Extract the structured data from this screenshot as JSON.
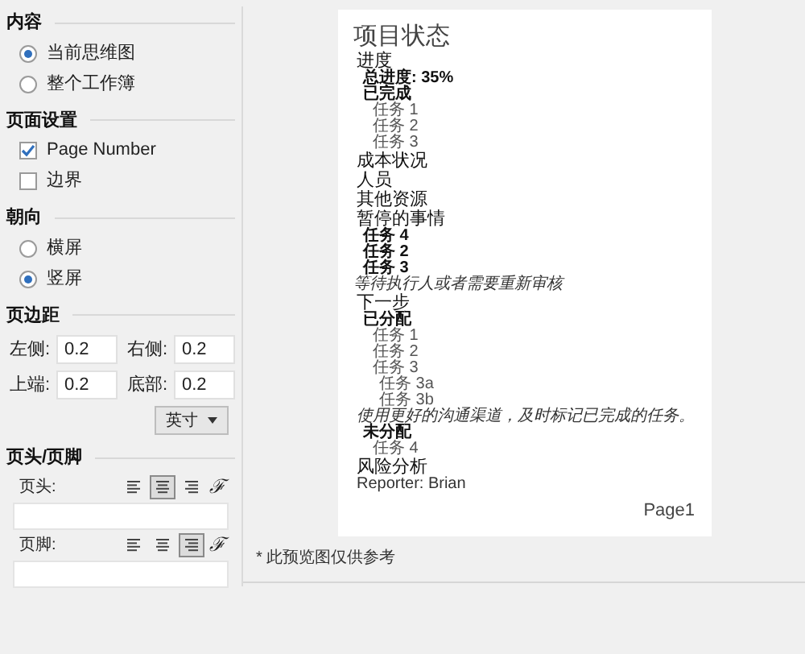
{
  "content": {
    "title": "内容",
    "options": [
      {
        "label": "当前思维图",
        "selected": true
      },
      {
        "label": "整个工作簿",
        "selected": false
      }
    ]
  },
  "page_setup": {
    "title": "页面设置",
    "options": [
      {
        "label": "Page Number",
        "checked": true
      },
      {
        "label": "边界",
        "checked": false
      }
    ]
  },
  "orientation": {
    "title": "朝向",
    "options": [
      {
        "label": "横屏",
        "selected": false
      },
      {
        "label": "竖屏",
        "selected": true
      }
    ]
  },
  "margins": {
    "title": "页边距",
    "fields": [
      {
        "label": "左侧:",
        "value": "0.2"
      },
      {
        "label": "右侧:",
        "value": "0.2"
      },
      {
        "label": "上端:",
        "value": "0.2"
      },
      {
        "label": "底部:",
        "value": "0.2"
      }
    ],
    "unit": "英寸"
  },
  "header_footer": {
    "title": "页头/页脚",
    "rows": [
      {
        "label": "页头:",
        "align": [
          {
            "kind": "left",
            "selected": false
          },
          {
            "kind": "center",
            "selected": true
          },
          {
            "kind": "right",
            "selected": false
          }
        ],
        "font_button": "ℱ"
      },
      {
        "label": "页脚:",
        "align": [
          {
            "kind": "left",
            "selected": false
          },
          {
            "kind": "center",
            "selected": false
          },
          {
            "kind": "right",
            "selected": true
          }
        ],
        "font_button": "ℱ"
      }
    ]
  },
  "preview": {
    "lines": [
      {
        "kind": "title",
        "text": "项目状态",
        "children": [
          {
            "kind": "heading",
            "text": "进度",
            "children": [
              {
                "kind": "bold",
                "text": "总进度: 35%"
              },
              {
                "kind": "bold",
                "text": "已完成",
                "children": [
                  {
                    "kind": "normal",
                    "text": "任务 1"
                  },
                  {
                    "kind": "normal",
                    "text": "任务 2"
                  },
                  {
                    "kind": "normal",
                    "text": "任务 3"
                  }
                ]
              }
            ]
          },
          {
            "kind": "heading",
            "text": "成本状况"
          },
          {
            "kind": "heading",
            "text": "人员"
          },
          {
            "kind": "heading",
            "text": "其他资源"
          },
          {
            "kind": "heading",
            "text": "暂停的事情",
            "children": [
              {
                "kind": "bold",
                "text": "任务 4"
              },
              {
                "kind": "bold",
                "text": "任务 2"
              },
              {
                "kind": "bold",
                "text": "任务 3"
              }
            ]
          },
          {
            "kind": "note",
            "text": "等待执行人或者需要重新审核"
          },
          {
            "kind": "heading",
            "text": "下一步",
            "children": [
              {
                "kind": "bold",
                "text": "已分配",
                "children": [
                  {
                    "kind": "normal",
                    "text": "任务 1"
                  },
                  {
                    "kind": "normal",
                    "text": "任务 2"
                  },
                  {
                    "kind": "normal",
                    "text": "任务 3",
                    "children": [
                      {
                        "kind": "normal",
                        "text": "任务 3a"
                      },
                      {
                        "kind": "normal",
                        "text": "任务 3b"
                      }
                    ]
                  }
                ]
              },
              {
                "kind": "note",
                "text": "使用更好的沟通渠道，及时标记已完成的任务。"
              },
              {
                "kind": "bold",
                "text": "未分配",
                "children": [
                  {
                    "kind": "normal",
                    "text": "任务 4"
                  }
                ]
              }
            ]
          },
          {
            "kind": "heading",
            "text": "风险分析"
          },
          {
            "kind": "small",
            "text": "Reporter: Brian"
          }
        ]
      }
    ],
    "page_label": "Page1"
  },
  "footnote": "* 此预览图仅供参考"
}
